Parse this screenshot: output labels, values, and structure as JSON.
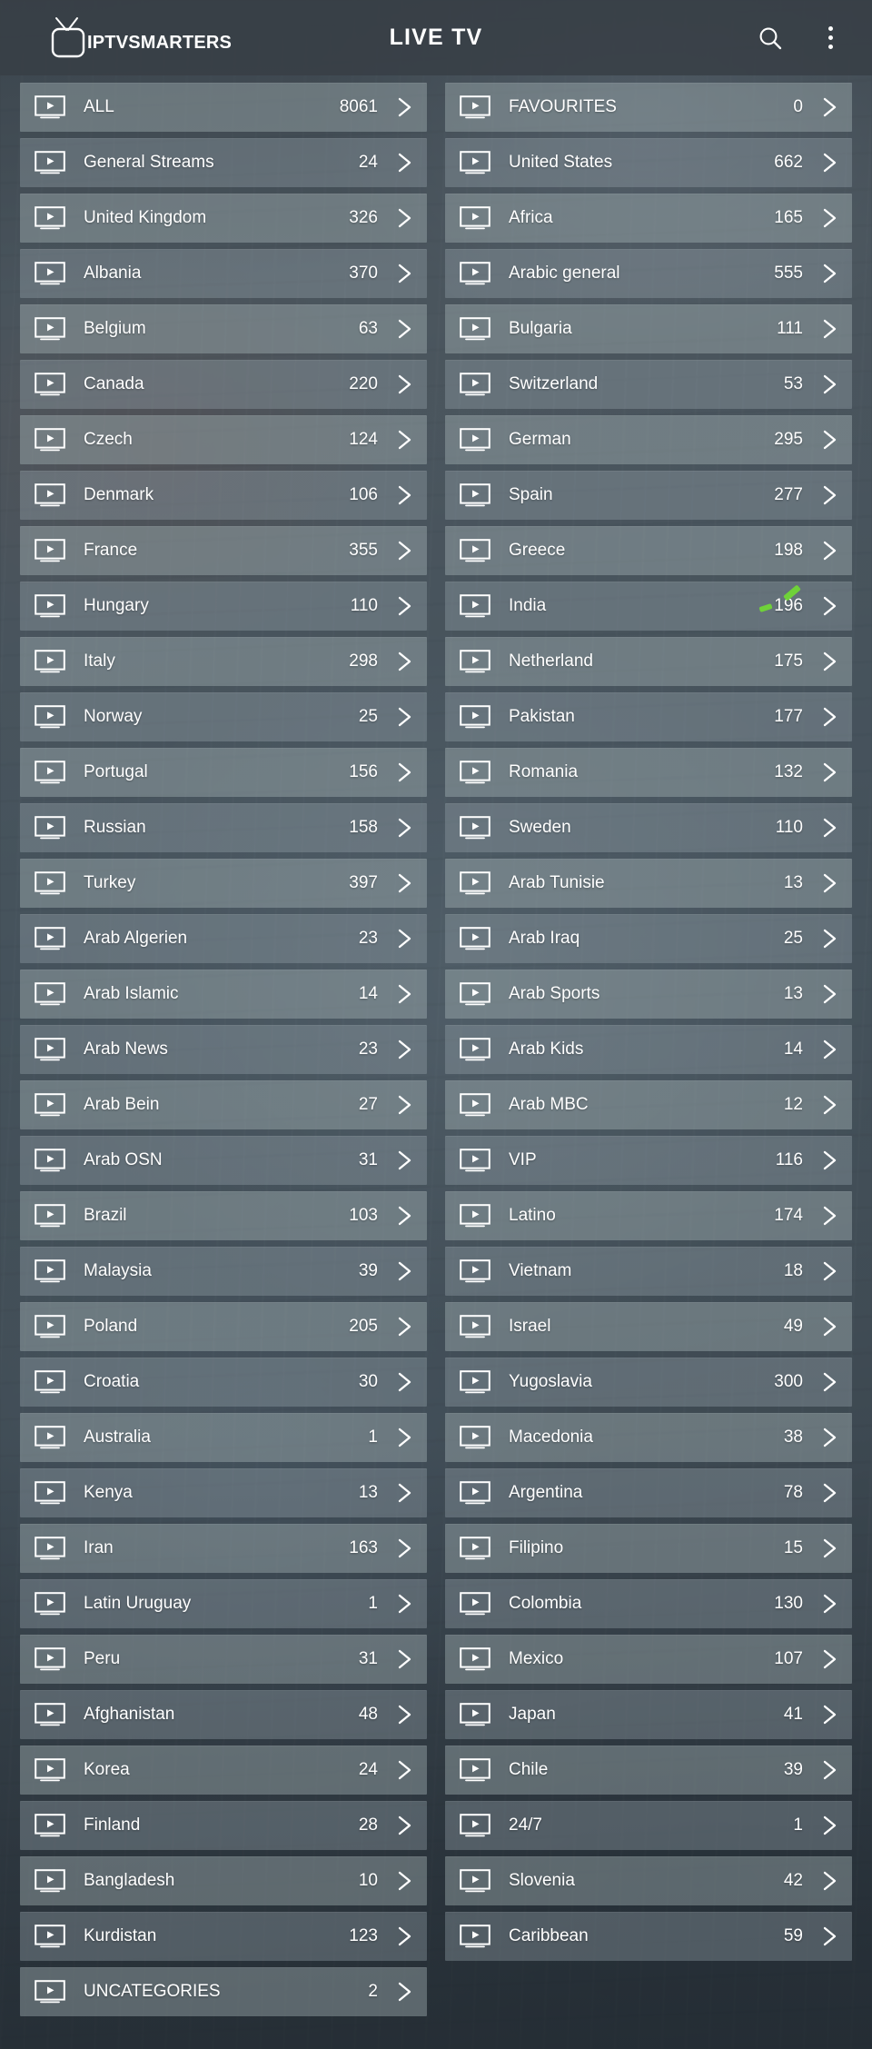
{
  "header": {
    "brand_initials": "IPTV",
    "brand_name": "SMARTERS",
    "title": "LIVE TV",
    "search_icon": "search-icon",
    "overflow_icon": "kebab-menu-icon"
  },
  "colors": {
    "accent_green": "#6fd139",
    "row_background": "rgba(168,180,184,0.42)",
    "header_background": "rgba(56,63,70,0.86)",
    "text": "#ffffff"
  },
  "list": {
    "row_icon": "tv-play-icon",
    "row_chevron_icon": "chevron-right-icon",
    "left_column": [
      {
        "label": "ALL",
        "count": "8061"
      },
      {
        "label": "General Streams",
        "count": "24"
      },
      {
        "label": "United Kingdom",
        "count": "326"
      },
      {
        "label": "Albania",
        "count": "370"
      },
      {
        "label": "Belgium",
        "count": "63"
      },
      {
        "label": "Canada",
        "count": "220"
      },
      {
        "label": "Czech",
        "count": "124"
      },
      {
        "label": "Denmark",
        "count": "106"
      },
      {
        "label": "France",
        "count": "355"
      },
      {
        "label": "Hungary",
        "count": "110"
      },
      {
        "label": "Italy",
        "count": "298"
      },
      {
        "label": "Norway",
        "count": "25"
      },
      {
        "label": "Portugal",
        "count": "156"
      },
      {
        "label": "Russian",
        "count": "158"
      },
      {
        "label": "Turkey",
        "count": "397"
      },
      {
        "label": "Arab Algerien",
        "count": "23"
      },
      {
        "label": "Arab Islamic",
        "count": "14"
      },
      {
        "label": "Arab News",
        "count": "23"
      },
      {
        "label": "Arab Bein",
        "count": "27"
      },
      {
        "label": "Arab OSN",
        "count": "31"
      },
      {
        "label": "Brazil",
        "count": "103"
      },
      {
        "label": "Malaysia",
        "count": "39"
      },
      {
        "label": "Poland",
        "count": "205"
      },
      {
        "label": "Croatia",
        "count": "30"
      },
      {
        "label": "Australia",
        "count": "1"
      },
      {
        "label": "Kenya",
        "count": "13"
      },
      {
        "label": "Iran",
        "count": "163"
      },
      {
        "label": "Latin Uruguay",
        "count": "1"
      },
      {
        "label": "Peru",
        "count": "31"
      },
      {
        "label": "Afghanistan",
        "count": "48"
      },
      {
        "label": "Korea",
        "count": "24"
      },
      {
        "label": "Finland",
        "count": "28"
      },
      {
        "label": "Bangladesh",
        "count": "10"
      },
      {
        "label": "Kurdistan",
        "count": "123"
      },
      {
        "label": "UNCATEGORIES",
        "count": "2"
      }
    ],
    "right_column": [
      {
        "label": "FAVOURITES",
        "count": "0"
      },
      {
        "label": "United States",
        "count": "662"
      },
      {
        "label": "Africa",
        "count": "165"
      },
      {
        "label": "Arabic general",
        "count": "555"
      },
      {
        "label": "Bulgaria",
        "count": "111"
      },
      {
        "label": "Switzerland",
        "count": "53"
      },
      {
        "label": "German",
        "count": "295"
      },
      {
        "label": "Spain",
        "count": "277"
      },
      {
        "label": "Greece",
        "count": "198"
      },
      {
        "label": "India",
        "count": "196",
        "annotated": true
      },
      {
        "label": "Netherland",
        "count": "175"
      },
      {
        "label": "Pakistan",
        "count": "177"
      },
      {
        "label": "Romania",
        "count": "132"
      },
      {
        "label": "Sweden",
        "count": "110"
      },
      {
        "label": "Arab Tunisie",
        "count": "13"
      },
      {
        "label": "Arab Iraq",
        "count": "25"
      },
      {
        "label": "Arab Sports",
        "count": "13"
      },
      {
        "label": "Arab Kids",
        "count": "14"
      },
      {
        "label": "Arab MBC",
        "count": "12"
      },
      {
        "label": "VIP",
        "count": "116"
      },
      {
        "label": "Latino",
        "count": "174"
      },
      {
        "label": "Vietnam",
        "count": "18"
      },
      {
        "label": "Israel",
        "count": "49"
      },
      {
        "label": "Yugoslavia",
        "count": "300"
      },
      {
        "label": "Macedonia",
        "count": "38"
      },
      {
        "label": "Argentina",
        "count": "78"
      },
      {
        "label": "Filipino",
        "count": "15"
      },
      {
        "label": "Colombia",
        "count": "130"
      },
      {
        "label": "Mexico",
        "count": "107"
      },
      {
        "label": "Japan",
        "count": "41"
      },
      {
        "label": "Chile",
        "count": "39"
      },
      {
        "label": "24/7",
        "count": "1"
      },
      {
        "label": "Slovenia",
        "count": "42"
      },
      {
        "label": "Caribbean",
        "count": "59"
      }
    ]
  }
}
